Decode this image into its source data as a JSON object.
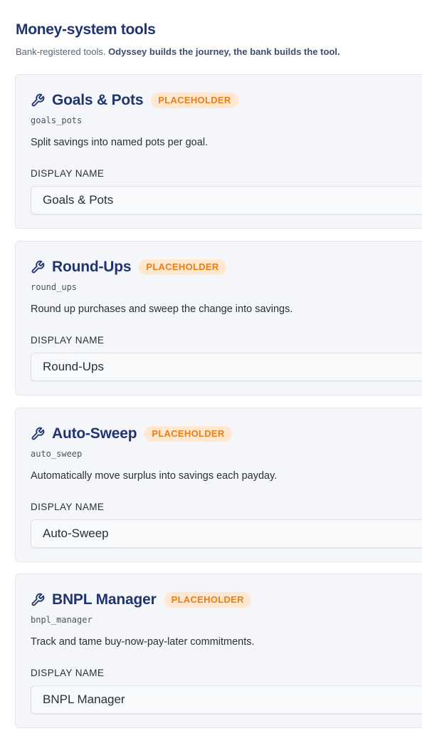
{
  "section": {
    "title": "Money-system tools",
    "subtitle_prefix": "Bank-registered tools. ",
    "subtitle_bold": "Odyssey builds the journey, the bank builds the tool."
  },
  "colors": {
    "title": "#1f3470",
    "badge_bg": "#ffe8cf",
    "badge_text": "#ea7d18",
    "icon": "#1f3470"
  },
  "tools": [
    {
      "name": "Goals & Pots",
      "status": "PLACEHOLDER",
      "id": "goals_pots",
      "description": "Split savings into named pots per goal.",
      "field_label": "DISPLAY NAME",
      "display_name": "Goals & Pots",
      "icon": "wrench-icon"
    },
    {
      "name": "Round-Ups",
      "status": "PLACEHOLDER",
      "id": "round_ups",
      "description": "Round up purchases and sweep the change into savings.",
      "field_label": "DISPLAY NAME",
      "display_name": "Round-Ups",
      "icon": "wrench-icon"
    },
    {
      "name": "Auto-Sweep",
      "status": "PLACEHOLDER",
      "id": "auto_sweep",
      "description": "Automatically move surplus into savings each payday.",
      "field_label": "DISPLAY NAME",
      "display_name": "Auto-Sweep",
      "icon": "wrench-icon"
    },
    {
      "name": "BNPL Manager",
      "status": "PLACEHOLDER",
      "id": "bnpl_manager",
      "description": "Track and tame buy-now-pay-later commitments.",
      "field_label": "DISPLAY NAME",
      "display_name": "BNPL Manager",
      "icon": "wrench-icon"
    }
  ]
}
